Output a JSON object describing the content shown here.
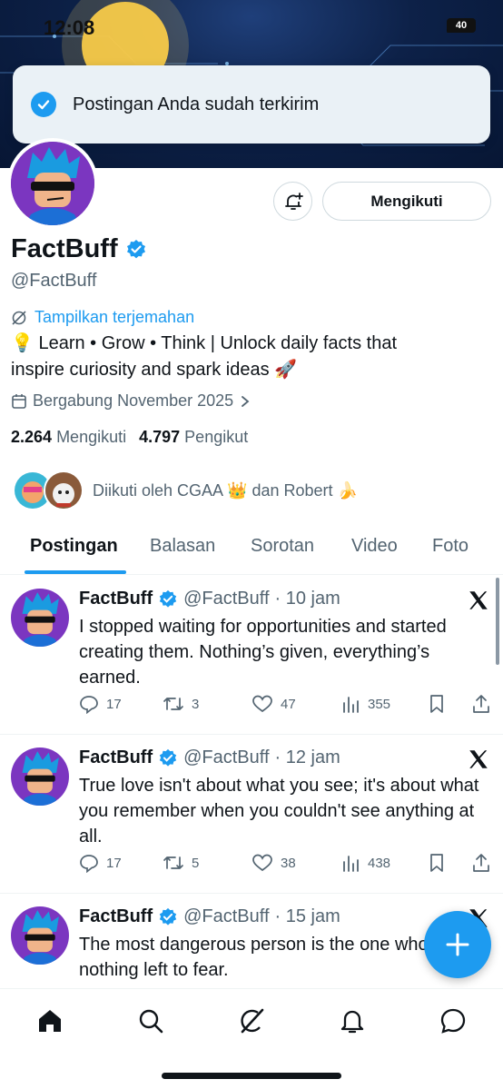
{
  "status_bar": {
    "time": "12:08",
    "battery": "40"
  },
  "toast": {
    "message": "Postingan Anda sudah terkirim"
  },
  "profile": {
    "follow_label": "Mengikuti",
    "name": "FactBuff",
    "handle": "@FactBuff",
    "translate_label": "Tampilkan terjemahan",
    "bio_line1": "💡 Learn • Grow • Think | Unlock daily facts that",
    "bio_line2": "inspire curiosity and spark ideas 🚀",
    "joined": "Bergabung November 2025",
    "following_count": "2.264",
    "following_label": "Mengikuti",
    "followers_count": "4.797",
    "followers_label": "Pengikut",
    "followed_by": "Diikuti oleh CGAA 👑 dan Robert 🍌"
  },
  "tabs": [
    {
      "label": "Postingan",
      "active": true
    },
    {
      "label": "Balasan"
    },
    {
      "label": "Sorotan"
    },
    {
      "label": "Video"
    },
    {
      "label": "Foto"
    }
  ],
  "posts": [
    {
      "name": "FactBuff",
      "handle": "@FactBuff",
      "time": "· 10 jam",
      "text": "I stopped waiting for opportunities and started creating them. Nothing’s given, everything’s earned.",
      "replies": "17",
      "reposts": "3",
      "likes": "47",
      "views": "355"
    },
    {
      "name": "FactBuff",
      "handle": "@FactBuff",
      "time": "· 12 jam",
      "text": "True love isn't about what you see; it's about what you remember when you couldn't see anything at all.",
      "replies": "17",
      "reposts": "5",
      "likes": "38",
      "views": "438"
    },
    {
      "name": "FactBuff",
      "handle": "@FactBuff",
      "time": "· 15 jam",
      "text": "The most dangerous person is the one who has nothing left to fear."
    }
  ],
  "colors": {
    "accent": "#1d9bf0",
    "text": "#0f1419",
    "muted": "#536471"
  },
  "bottom_nav": [
    "home-icon",
    "search-icon",
    "grok-icon",
    "notifications-icon",
    "messages-icon"
  ]
}
